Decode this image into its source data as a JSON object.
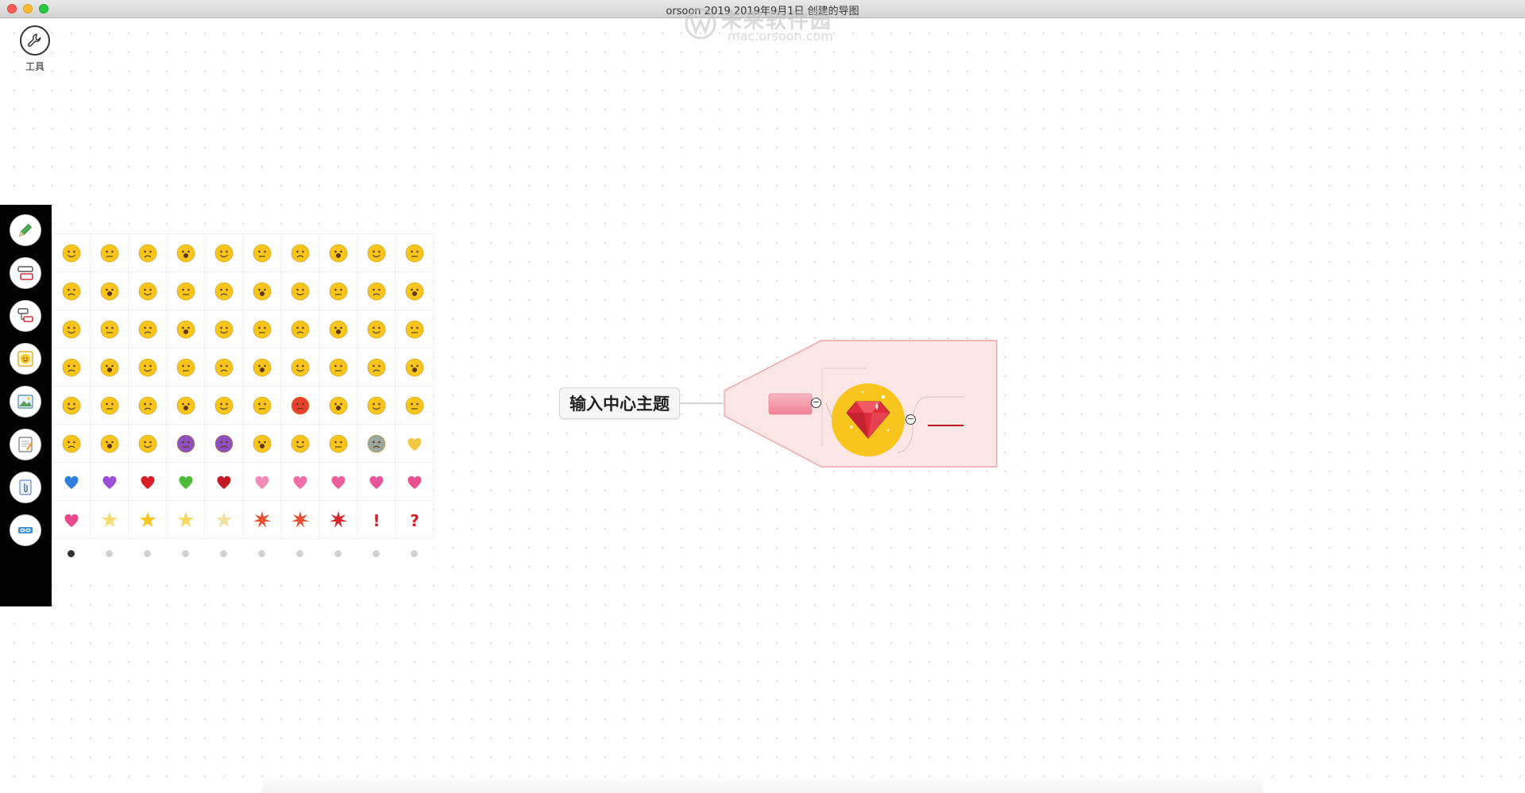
{
  "window": {
    "title": "orsoon 2019 2019年9月1日 创建的导图"
  },
  "watermark": {
    "text": "未来软件园",
    "url": "mac.orsoon.com"
  },
  "toolbar": {
    "tools_label": "工具"
  },
  "left_toolbar": {
    "buttons": [
      "pen-icon",
      "topic-style-icon",
      "subtopic-style-icon",
      "emoji-sticker-icon",
      "image-icon",
      "note-icon",
      "attachment-icon",
      "link-icon"
    ]
  },
  "emoji_panel": {
    "rows": 8,
    "columns": 10,
    "pages": 10,
    "active_page": 1
  },
  "mindmap": {
    "central_topic": "输入中心主题",
    "colors": {
      "boundary_fill": "#fde6e6",
      "boundary_stroke": "#f0a5a5",
      "topic_fill": "#f29aa9",
      "gem_circle": "#f7c51e",
      "gem": "#e02d3c",
      "branch_line": "#c0121c"
    }
  }
}
